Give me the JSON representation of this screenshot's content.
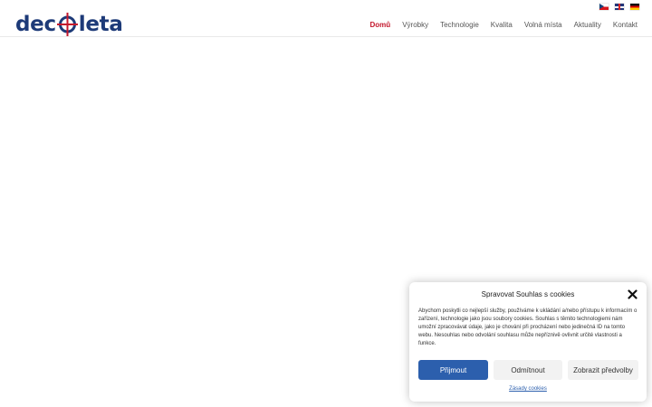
{
  "brand": {
    "part1": "dec",
    "part2": "leta",
    "colors": {
      "text": "#1d3a78",
      "accent": "#c4172c"
    }
  },
  "languages": [
    {
      "icon": "flag-cz-icon"
    },
    {
      "icon": "flag-en-icon"
    },
    {
      "icon": "flag-de-icon"
    }
  ],
  "nav": {
    "items": [
      "Domů",
      "Výrobky",
      "Technologie",
      "Kvalita",
      "Volná místa",
      "Aktuality",
      "Kontakt"
    ],
    "active": "Domů"
  },
  "cookie": {
    "title": "Spravovat Souhlas s cookies",
    "text": "Abychom poskytli co nejlepší služby, používáme k ukládání a/nebo přístupu k informacím o zařízení, technologie jako jsou soubory cookies. Souhlas s těmito technologiemi nám umožní zpracovávat údaje, jako je chování při procházení nebo jedinečná ID na tomto webu. Nesouhlas nebo odvolání souhlasu může nepříznivě ovlivnit určité vlastnosti a funkce.",
    "accept_label": "Přijmout",
    "deny_label": "Odmítnout",
    "prefs_label": "Zobrazit předvolby",
    "policy_link": "Zásady cookies",
    "accent": "#2c5fad"
  }
}
